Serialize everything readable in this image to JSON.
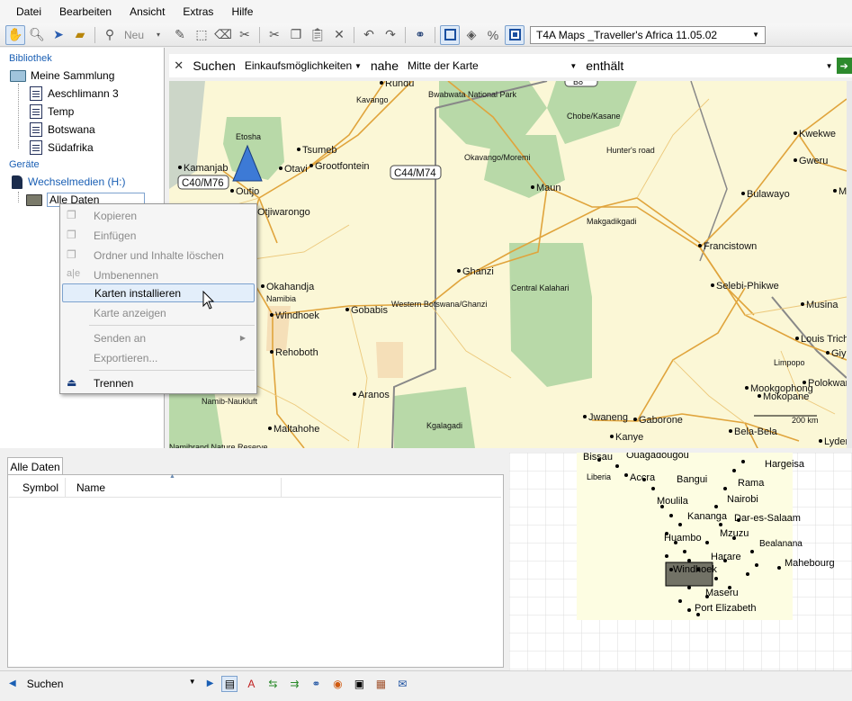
{
  "menubar": {
    "items": [
      "Datei",
      "Bearbeiten",
      "Ansicht",
      "Extras",
      "Hilfe"
    ]
  },
  "toolbar": {
    "new_label": "Neu",
    "map_product": "T4A Maps _Traveller's Africa 11.05.02"
  },
  "library": {
    "header": "Bibliothek",
    "root": "Meine Sammlung",
    "items": [
      "Aeschlimann 3",
      "Temp",
      "Botswana",
      "Südafrika"
    ]
  },
  "devices": {
    "header": "Geräte",
    "device": "Wechselmedien (H:)",
    "folder": "Alle Daten"
  },
  "search": {
    "label": "Suchen",
    "category": "Einkaufsmöglichkeiten",
    "near_label": "nahe",
    "near_value": "Mitte der Karte",
    "contains_label": "enthält"
  },
  "context_menu": {
    "copy": "Kopieren",
    "paste": "Einfügen",
    "delete": "Ordner und Inhalte löschen",
    "rename": "Umbenennen",
    "install": "Karten installieren",
    "show": "Karte anzeigen",
    "send_to": "Senden an",
    "export": "Exportieren...",
    "disconnect": "Trennen"
  },
  "map": {
    "places": [
      "Rundu",
      "Bwabwata National Park",
      "Kavango",
      "Chobe/Kasane",
      "Etosha",
      "Tsumeb",
      "Kamanjab",
      "Otavi",
      "Grootfontein",
      "Okavango/Moremi",
      "Hunter's road",
      "Kwekwe",
      "Gweru",
      "Outjo",
      "Maun",
      "Bulawayo",
      "Otjiwarongo",
      "Makgadikgadi",
      "Francistown",
      "Ghanzi",
      "Okahandja",
      "Namibia",
      "Central Kalahari",
      "Selebi-Phikwe",
      "Windhoek",
      "Gobabis",
      "Western Botswana/Ghanzi",
      "Musina",
      "Louis Tricha",
      "Giya",
      "Rehoboth",
      "Limpopo",
      "Polokwane",
      "Aranos",
      "Mokopane",
      "Namib-Naukluft",
      "Mookgophong",
      "Jwaneng",
      "Gaborone",
      "Maltahohe",
      "Kgalagadi",
      "Kanye",
      "Bela-Bela",
      "Lydenb",
      "Namibrand Nature Reserve",
      "Ma"
    ],
    "road_labels": [
      "C40/M76",
      "C44/M74",
      "B8"
    ],
    "scale": "200 km"
  },
  "list": {
    "tab": "Alle Daten",
    "col_symbol": "Symbol",
    "col_name": "Name"
  },
  "overview": {
    "places": [
      "Bissau",
      "Ouagadougou",
      "Hargeisa",
      "Liberia",
      "Accra",
      "Bangui",
      "Rama",
      "Moulila",
      "Nairobi",
      "Kananga",
      "Dar-es-Salaam",
      "Mzuzu",
      "Huambo",
      "Bealanana",
      "Harare",
      "Mahebourg",
      "Windhoek",
      "Maseru",
      "Port Elizabeth"
    ]
  },
  "statusbar": {
    "search": "Suchen"
  }
}
